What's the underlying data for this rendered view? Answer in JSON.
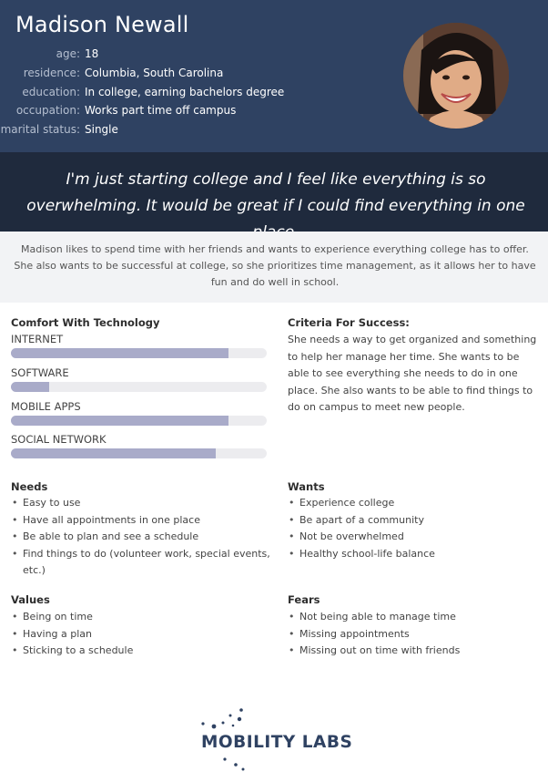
{
  "persona": {
    "name": "Madison Newall",
    "info": [
      {
        "label": "age:",
        "value": "18"
      },
      {
        "label": "residence:",
        "value": "Columbia, South Carolina"
      },
      {
        "label": "education:",
        "value": "In college, earning bachelors degree"
      },
      {
        "label": "occupation:",
        "value": "Works part time off campus"
      },
      {
        "label": "marital status:",
        "value": "Single"
      }
    ],
    "quote": "I'm just starting college and I feel like everything is so overwhelming. It would be great if I could find everything in one place.",
    "summary": "Madison likes to spend time with her friends and wants to experience everything college has to offer. She also wants to be successful at college, so she prioritizes time management, as it allows her to have fun and do well in school."
  },
  "technology": {
    "title": "Comfort With Technology",
    "items": [
      {
        "label": "INTERNET",
        "level": 0.85
      },
      {
        "label": "SOFTWARE",
        "level": 0.15
      },
      {
        "label": "MOBILE APPS",
        "level": 0.85
      },
      {
        "label": "SOCIAL NETWORK",
        "level": 0.8
      }
    ]
  },
  "criteria": {
    "title": "Criteria For Success:",
    "text": "She needs a way to get organized and something to help her manage her time. She wants to be able to see everything she needs to do in one place. She also wants to be able to find things to do on campus to meet new people."
  },
  "needs": {
    "title": "Needs",
    "items": [
      "Easy to use",
      "Have all appointments in one place",
      "Be able to plan and see a schedule",
      "Find things to do (volunteer work, special events, etc.)"
    ]
  },
  "wants": {
    "title": "Wants",
    "items": [
      "Experience college",
      "Be apart of a community",
      "Not be overwhelmed",
      "Healthy school-life balance"
    ]
  },
  "values": {
    "title": "Values",
    "items": [
      "Being on time",
      "Having a plan",
      "Sticking to a schedule"
    ]
  },
  "fears": {
    "title": "Fears",
    "items": [
      "Not being able to manage time",
      "Missing appointments",
      "Missing out on time with friends"
    ]
  },
  "brand": {
    "logo_text": "MOBILITY LABS",
    "primary_color": "#2f4262",
    "bar_color": "#a9abc9"
  }
}
